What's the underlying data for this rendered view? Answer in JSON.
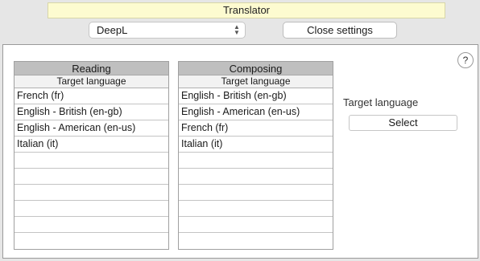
{
  "header": {
    "title": "Translator"
  },
  "service_select": {
    "value": "DeepL"
  },
  "close_settings_label": "Close settings",
  "help_label": "?",
  "reading": {
    "title": "Reading",
    "column": "Target language",
    "rows": [
      "French (fr)",
      "English - British (en-gb)",
      "English - American (en-us)",
      "Italian (it)",
      "",
      "",
      "",
      "",
      "",
      ""
    ]
  },
  "composing": {
    "title": "Composing",
    "column": "Target language",
    "rows": [
      "English - British (en-gb)",
      "English - American (en-us)",
      "French (fr)",
      "Italian (it)",
      "",
      "",
      "",
      "",
      "",
      ""
    ]
  },
  "target_language_label": "Target language",
  "select_label": "Select"
}
